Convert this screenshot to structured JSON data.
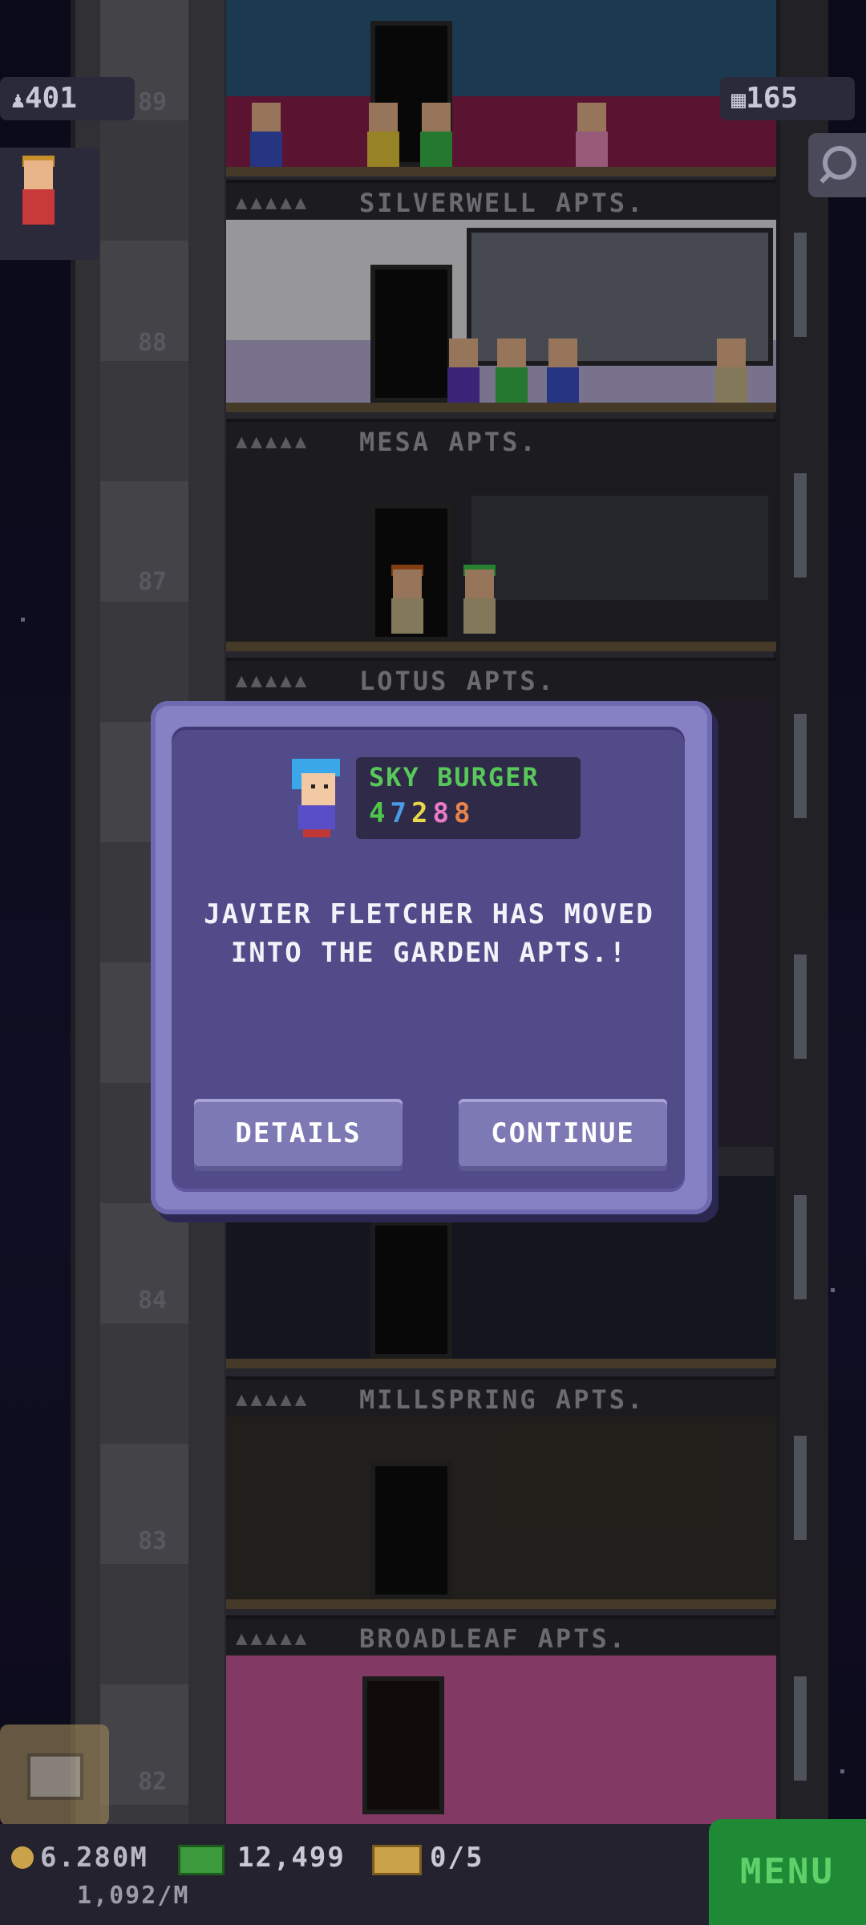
{
  "hud": {
    "population": "401",
    "population_icon": "person-icon",
    "floors": "165",
    "floors_icon": "building-icon",
    "search_icon": "search-icon"
  },
  "floors": [
    {
      "number": "89",
      "name": "SILVERWELL APTS.",
      "dots": "▲▲▲▲▲"
    },
    {
      "number": "88",
      "name": "MESA APTS.",
      "dots": "▲▲▲▲▲"
    },
    {
      "number": "87",
      "name": "LOTUS APTS.",
      "dots": "▲▲▲▲▲"
    },
    {
      "number": "84",
      "name": "MILLSPRING APTS.",
      "dots": "▲▲▲▲▲"
    },
    {
      "number": "83",
      "name": "BROADLEAF APTS.",
      "dots": "▲▲▲▲▲"
    },
    {
      "number": "82"
    }
  ],
  "dialog": {
    "job_name": "SKY BURGER",
    "skill_digits": [
      "4",
      "7",
      "2",
      "8",
      "8"
    ],
    "skill_colors": [
      "#4fc84a",
      "#4a9ae8",
      "#e8d84a",
      "#e87ac8",
      "#e8844a"
    ],
    "message": "JAVIER FLETCHER HAS MOVED INTO THE GARDEN APTS.!",
    "details_label": "DETAILS",
    "continue_label": "CONTINUE"
  },
  "bottom": {
    "coins": "6.280M",
    "coins_rate": "1,092/M",
    "bux": "12,499",
    "tickets": "0/5",
    "menu_label": "MENU"
  },
  "colors": {
    "menu": "#1f8a36",
    "dialog_bg": "#524b8a"
  }
}
